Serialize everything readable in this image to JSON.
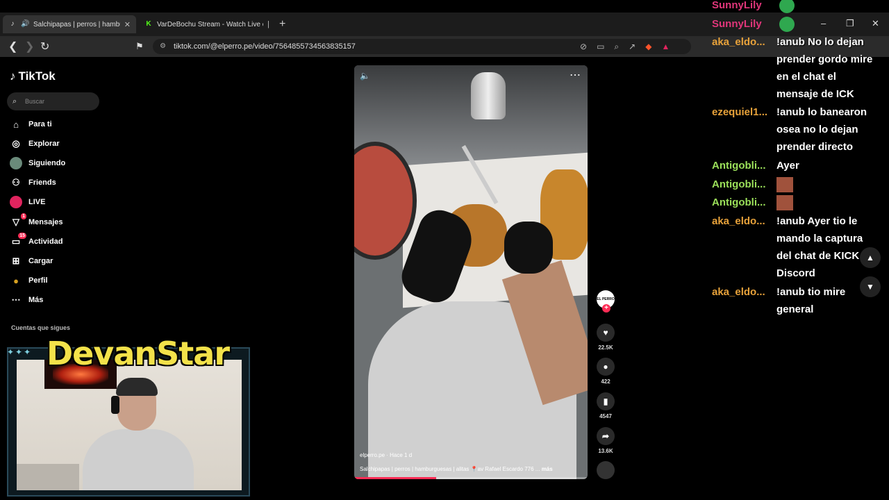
{
  "tabs": [
    {
      "title": "Salchipapas | perros | hambu",
      "favicon": "tiktok-icon",
      "audio": true
    },
    {
      "title": "VarDeBochu Stream - Watch Live on",
      "favicon": "kick-icon"
    }
  ],
  "address": {
    "url": "tiktok.com/@elperro.pe/video/7564855734563835157"
  },
  "tiktok": {
    "logo": "TikTok",
    "search_placeholder": "Buscar",
    "nav": [
      {
        "label": "Para ti",
        "icon": "home-icon"
      },
      {
        "label": "Explorar",
        "icon": "compass-icon"
      },
      {
        "label": "Siguiendo",
        "icon": "following-avatar-icon"
      },
      {
        "label": "Friends",
        "icon": "friends-icon"
      },
      {
        "label": "LIVE",
        "icon": "live-icon"
      },
      {
        "label": "Mensajes",
        "icon": "messages-icon",
        "badge": "1"
      },
      {
        "label": "Actividad",
        "icon": "activity-icon",
        "badge": "15"
      },
      {
        "label": "Cargar",
        "icon": "upload-icon"
      },
      {
        "label": "Perfil",
        "icon": "profile-icon"
      },
      {
        "label": "Más",
        "icon": "more-icon"
      }
    ],
    "following_title": "Cuentas que sigues"
  },
  "video": {
    "meta": "elperro.pe · Hace 1 d",
    "caption": "Salchipapas | perros | hamburguesas | alitas 📍av Rafael Escardo 776 ...",
    "more": "más",
    "progress": 0.35
  },
  "rail": {
    "likes": "22.5K",
    "comments": "422",
    "saves": "4547",
    "shares": "13.6K",
    "avatar_text": "EL PERRO"
  },
  "streamer": {
    "name": "DevanStar"
  },
  "chat": [
    {
      "user": "SunnyLily",
      "color": "#e0367a",
      "text": "",
      "emote": "round"
    },
    {
      "user": "SunnyLily",
      "color": "#e0367a",
      "text": "",
      "emote": "round"
    },
    {
      "user": "aka_eldo...",
      "color": "#e8a23a",
      "text": "!anub No lo dejan prender gordo mire en el chat el mensaje de ICK"
    },
    {
      "user": "ezequiel1...",
      "color": "#e8a23a",
      "text": "!anub lo banearon osea no lo dejan prender directo"
    },
    {
      "user": "Antigobli...",
      "color": "#9be05a",
      "text": "Ayer"
    },
    {
      "user": "Antigobli...",
      "color": "#9be05a",
      "text": "",
      "emote": "square"
    },
    {
      "user": "Antigobli...",
      "color": "#9be05a",
      "text": "",
      "emote": "square"
    },
    {
      "user": "aka_eldo...",
      "color": "#e8a23a",
      "text": "!anub Ayer tio le mando la captura del chat de KICK por Discord"
    },
    {
      "user": "aka_eldo...",
      "color": "#e8a23a",
      "text": "!anub tio mire general"
    }
  ]
}
